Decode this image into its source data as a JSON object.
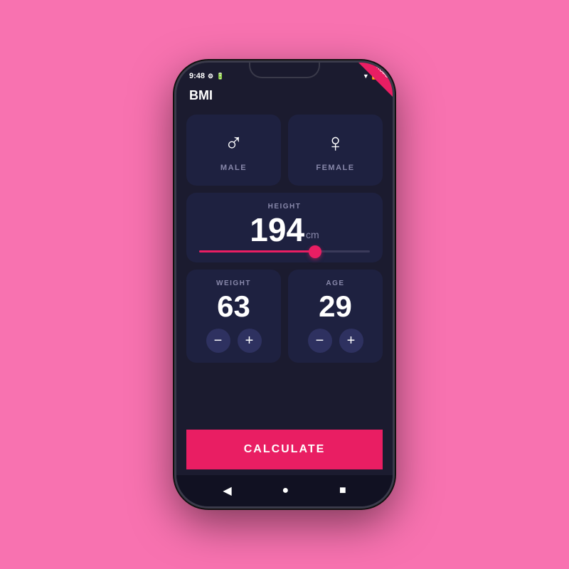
{
  "background_color": "#f872b0",
  "phone": {
    "status_bar": {
      "time": "9:48",
      "icons_left": [
        "settings-icon",
        "battery-icon"
      ],
      "icons_right": [
        "wifi-icon",
        "signal-icon"
      ]
    },
    "promo_badge_label": "PROMO",
    "app_title": "BMI",
    "gender": {
      "male_label": "MALE",
      "female_label": "FEMALE",
      "male_icon": "♂",
      "female_icon": "♀"
    },
    "height": {
      "label": "HEIGHT",
      "value": "194",
      "unit": "cm",
      "slider_percent": 68
    },
    "weight": {
      "label": "WEIGHT",
      "value": "63"
    },
    "age": {
      "label": "AGE",
      "value": "29"
    },
    "controls": {
      "minus_label": "−",
      "plus_label": "+"
    },
    "calculate_button_label": "CALCULATE",
    "bottom_nav": {
      "back_icon": "◀",
      "home_icon": "●",
      "menu_icon": "■"
    }
  }
}
